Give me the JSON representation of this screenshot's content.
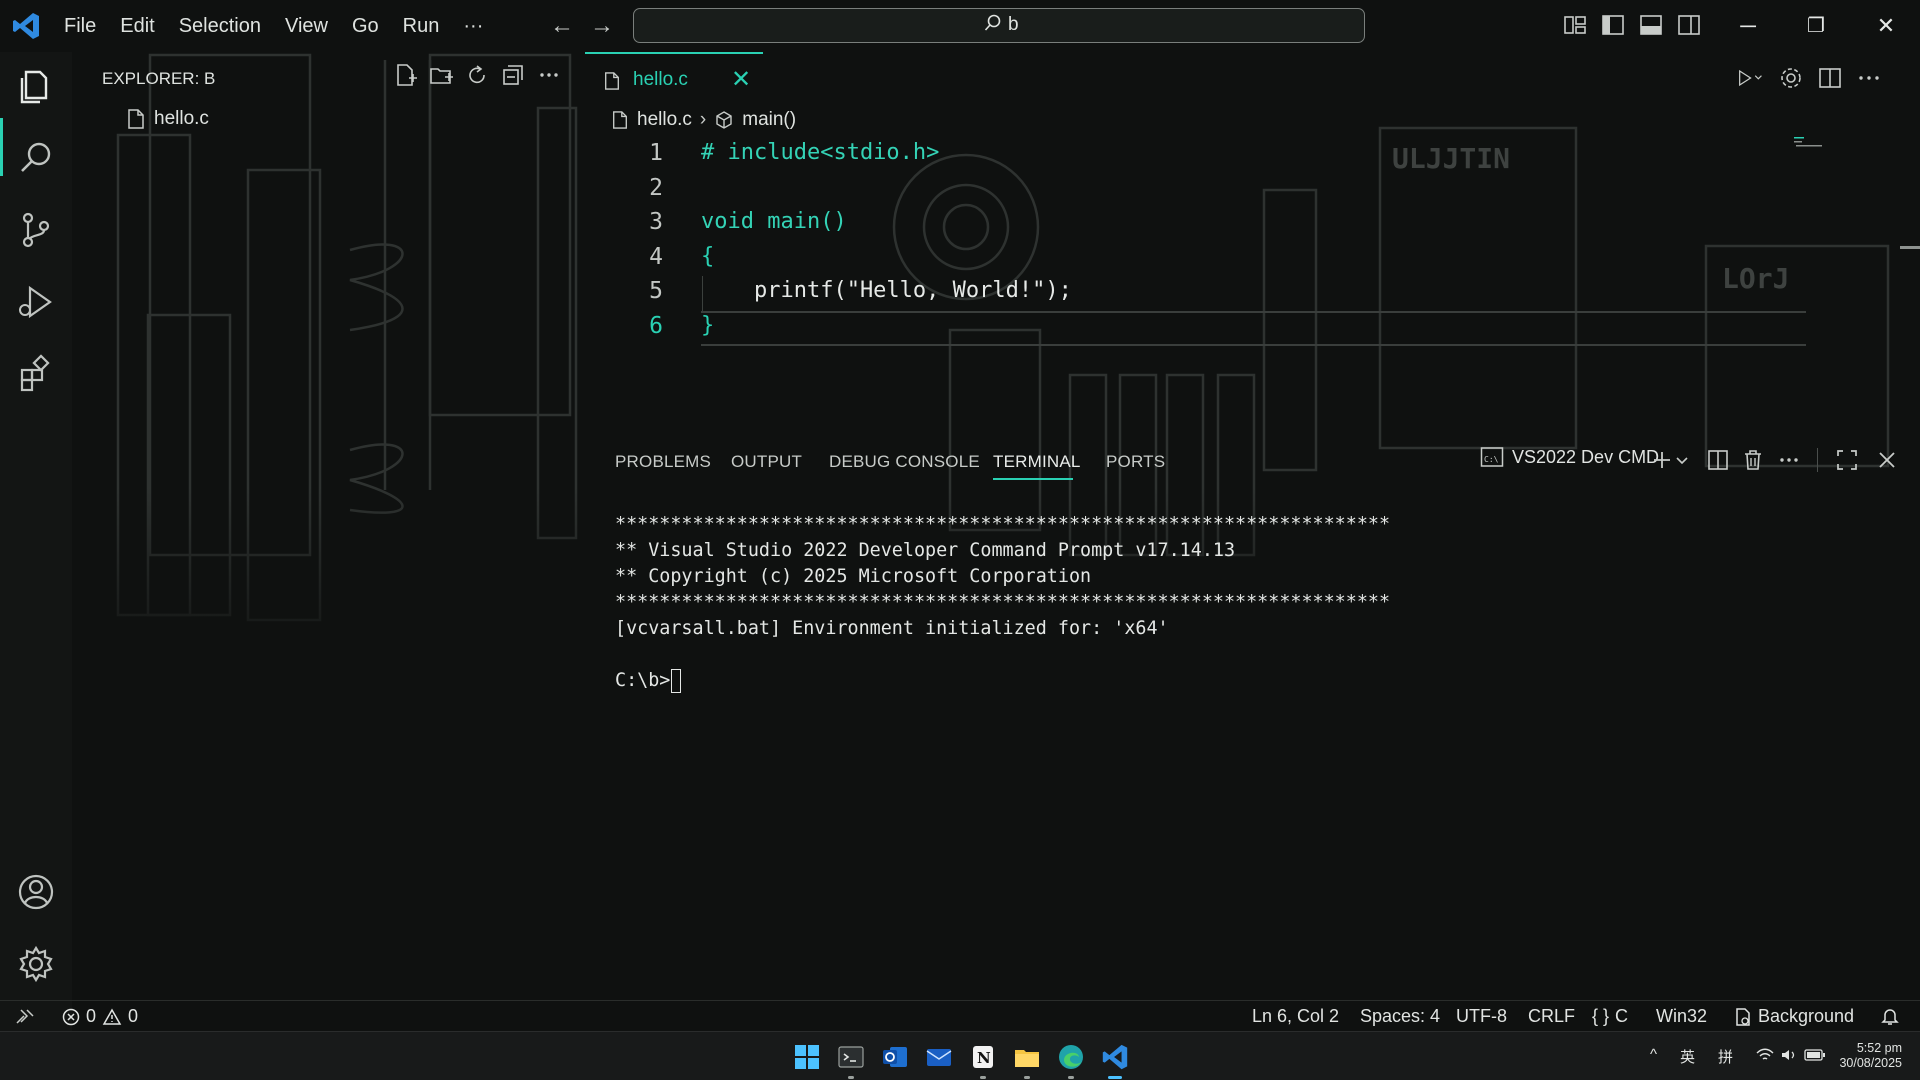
{
  "app": {
    "menu": [
      "File",
      "Edit",
      "Selection",
      "View",
      "Go",
      "Run"
    ],
    "menu_more": "···",
    "search_query": "b",
    "accent_color": "#2ad1b3"
  },
  "explorer": {
    "title": "EXPLORER: B",
    "files": [
      {
        "name": "hello.c",
        "icon": "file-icon"
      }
    ]
  },
  "editor": {
    "tab": {
      "label": "hello.c",
      "active": true
    },
    "breadcrumb": {
      "file": "hello.c",
      "symbol": "main()"
    },
    "lines": [
      {
        "num": "1",
        "text": "# include<stdio.h>"
      },
      {
        "num": "2",
        "text": ""
      },
      {
        "num": "3",
        "text": "void main()"
      },
      {
        "num": "4",
        "text": "{"
      },
      {
        "num": "5",
        "text": "    printf(\"Hello, World!\");"
      },
      {
        "num": "6",
        "text": "}"
      }
    ],
    "current_line": 6
  },
  "panel": {
    "tabs": [
      "PROBLEMS",
      "OUTPUT",
      "DEBUG CONSOLE",
      "TERMINAL",
      "PORTS"
    ],
    "active_tab": "TERMINAL",
    "terminal_name": "VS2022 Dev CMD",
    "terminal_lines": [
      "**********************************************************************",
      "** Visual Studio 2022 Developer Command Prompt v17.14.13",
      "** Copyright (c) 2025 Microsoft Corporation",
      "**********************************************************************",
      "[vcvarsall.bat] Environment initialized for: 'x64'",
      "",
      "C:\\b>"
    ]
  },
  "statusbar": {
    "errors": "0",
    "warnings": "0",
    "position": "Ln 6, Col 2",
    "spaces": "Spaces: 4",
    "encoding": "UTF-8",
    "eol": "CRLF",
    "language": "C",
    "language_icon": "{ }",
    "config": "Win32",
    "background": "Background"
  },
  "taskbar": {
    "apps": [
      "windows-start",
      "terminal",
      "outlook",
      "mail",
      "notion",
      "file-explorer",
      "edge",
      "vscode"
    ],
    "ime_lang": "英",
    "ime_mode": "拼",
    "time": "5:52 pm",
    "date": "30/08/2025"
  }
}
